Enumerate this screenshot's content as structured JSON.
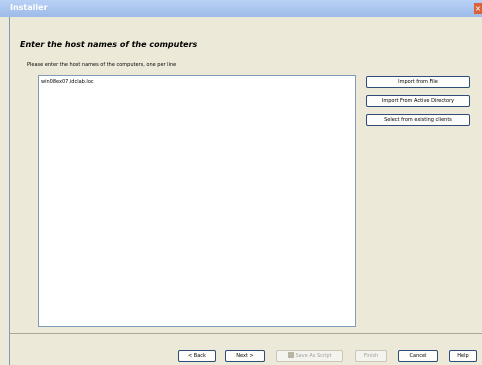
{
  "window": {
    "title": "Installer",
    "close_icon": "close-icon"
  },
  "page": {
    "heading": "Enter the host names of the computers",
    "instruction": "Please enter the host names of the computers, one per line",
    "hosts_text": "win08ex07.idclab.loc"
  },
  "side_buttons": {
    "import_file": "Import from File",
    "import_ad": "Import From Active Directory",
    "select_existing": "Select from existing clients"
  },
  "footer": {
    "back": "< Back",
    "next": "Next >",
    "save_script": "Save As Script",
    "finish": "Finish",
    "cancel": "Cancel",
    "help": "Help"
  }
}
